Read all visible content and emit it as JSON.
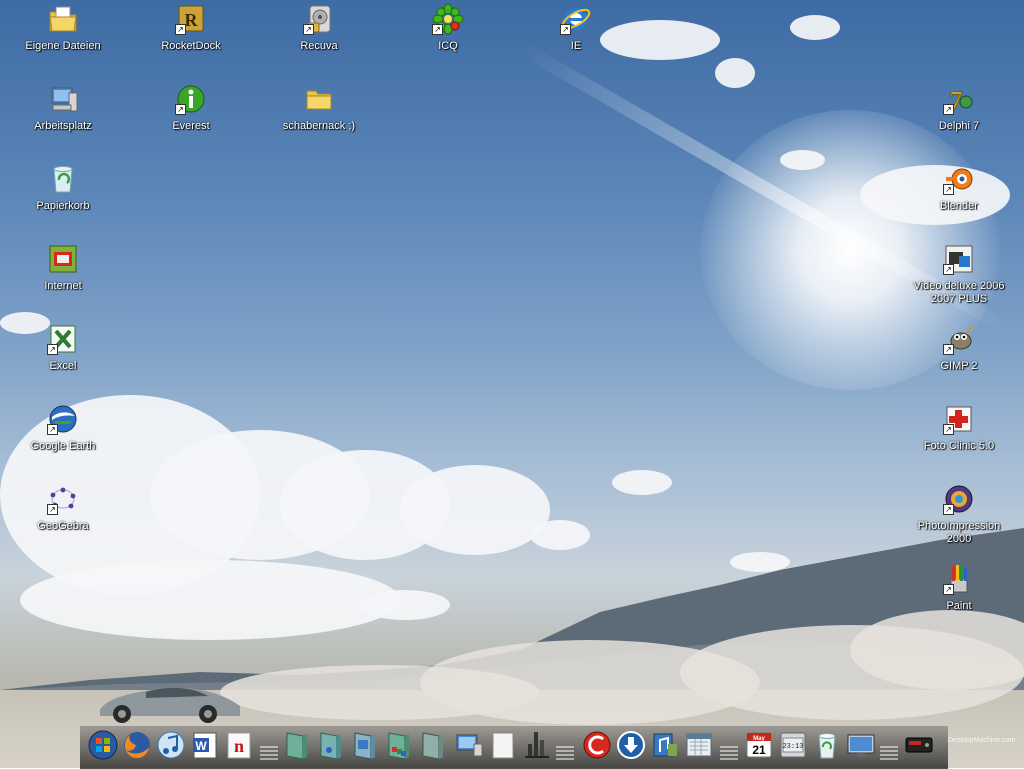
{
  "desktop": {
    "icons": [
      {
        "label": "Eigene Dateien",
        "icon": "documents-folder-icon"
      },
      {
        "label": "RocketDock",
        "icon": "rocketdock-icon"
      },
      {
        "label": "Recuva",
        "icon": "recuva-icon"
      },
      {
        "label": "ICQ",
        "icon": "icq-flower-icon"
      },
      {
        "label": "IE",
        "icon": "internet-explorer-icon"
      },
      {
        "label": "Arbeitsplatz",
        "icon": "computer-icon"
      },
      {
        "label": "Everest",
        "icon": "everest-info-icon"
      },
      {
        "label": "schabernack ;)",
        "icon": "folder-icon"
      },
      {
        "label": "Delphi 7",
        "icon": "delphi-icon"
      },
      {
        "label": "Papierkorb",
        "icon": "recycle-bin-icon"
      },
      {
        "label": "Blender",
        "icon": "blender-icon"
      },
      {
        "label": "Internet",
        "icon": "internet-app-icon"
      },
      {
        "label": "Video deluxe 2006 2007 PLUS",
        "icon": "video-deluxe-icon"
      },
      {
        "label": "Excel",
        "icon": "excel-icon"
      },
      {
        "label": "GIMP 2",
        "icon": "gimp-icon"
      },
      {
        "label": "Google Earth",
        "icon": "google-earth-icon"
      },
      {
        "label": "Foto Clinic 5.0",
        "icon": "foto-clinic-icon"
      },
      {
        "label": "GeoGebra",
        "icon": "geogebra-icon"
      },
      {
        "label": "PhotoImpression 2000",
        "icon": "photoimpression-icon"
      },
      {
        "label": "Paint",
        "icon": "paint-icon"
      }
    ]
  },
  "dock": {
    "items": [
      "windows-start-icon",
      "firefox-icon",
      "itunes-icon",
      "word-icon",
      "nero-icon",
      "book-green-icon",
      "book-blue-icon",
      "book-photo-icon",
      "book-colors-icon",
      "book-gray-icon",
      "network-computer-icon",
      "blank-document-icon",
      "chart-tool-icon",
      "cleaner-icon",
      "download-arrow-icon",
      "music-files-icon",
      "calendar-folder-icon",
      "calendar-icon",
      "clock-widget-icon",
      "recycle-bin-icon",
      "monitor-icon",
      "dvd-player-icon"
    ],
    "calendar": {
      "month": "May",
      "day": "21"
    },
    "clock": {
      "time": "23:13"
    },
    "watermark": "DesktopMachine.com"
  },
  "colors": {
    "sky_top": "#3d6ba3",
    "sky_bottom": "#c9d3db",
    "ground": "#d0cbbf",
    "label": "#ffffff"
  }
}
